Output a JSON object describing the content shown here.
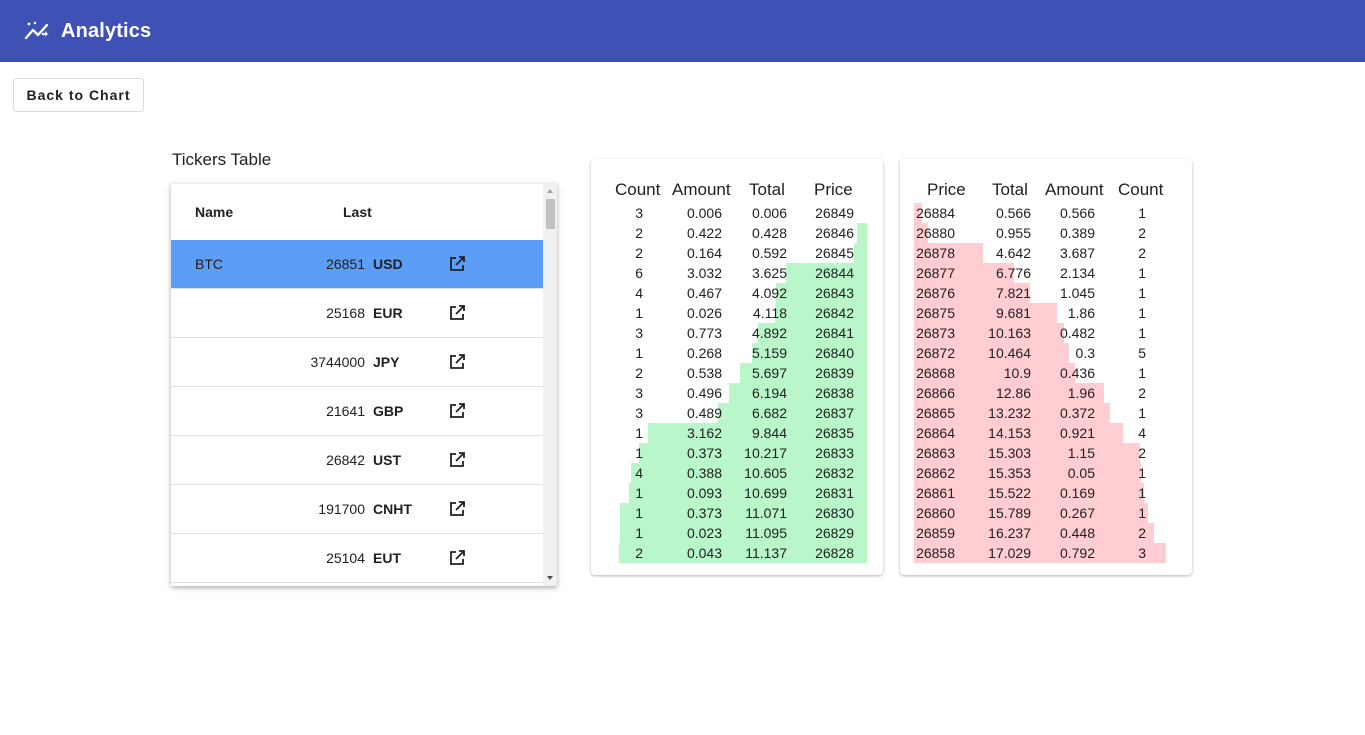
{
  "app": {
    "title": "Analytics",
    "logo_icon": "analytics-trend-icon",
    "bar_color": "#3f51b5"
  },
  "back_button": {
    "label": "Back to Chart"
  },
  "tickers": {
    "title": "Tickers Table",
    "headers": {
      "name": "Name",
      "last": "Last"
    },
    "selected_color": "#5b9df7",
    "rows": [
      {
        "name": "BTC",
        "last": "26851",
        "currency": "USD",
        "icon": "open-in-new-icon"
      },
      {
        "name": "",
        "last": "25168",
        "currency": "EUR",
        "icon": "open-in-new-icon"
      },
      {
        "name": "",
        "last": "3744000",
        "currency": "JPY",
        "icon": "open-in-new-icon"
      },
      {
        "name": "",
        "last": "21641",
        "currency": "GBP",
        "icon": "open-in-new-icon"
      },
      {
        "name": "",
        "last": "26842",
        "currency": "UST",
        "icon": "open-in-new-icon"
      },
      {
        "name": "",
        "last": "191700",
        "currency": "CNHT",
        "icon": "open-in-new-icon"
      },
      {
        "name": "",
        "last": "25104",
        "currency": "EUT",
        "icon": "open-in-new-icon"
      }
    ]
  },
  "bids": {
    "headers": {
      "count": "Count",
      "amount": "Amount",
      "total": "Total",
      "price": "Price"
    },
    "bar_color": "#b9f6ca",
    "max_total": 11.137,
    "rows": [
      {
        "count": "3",
        "amount": "0.006",
        "total": "0.006",
        "price": "26849"
      },
      {
        "count": "2",
        "amount": "0.422",
        "total": "0.428",
        "price": "26846"
      },
      {
        "count": "2",
        "amount": "0.164",
        "total": "0.592",
        "price": "26845"
      },
      {
        "count": "6",
        "amount": "3.032",
        "total": "3.625",
        "price": "26844"
      },
      {
        "count": "4",
        "amount": "0.467",
        "total": "4.092",
        "price": "26843"
      },
      {
        "count": "1",
        "amount": "0.026",
        "total": "4.118",
        "price": "26842"
      },
      {
        "count": "3",
        "amount": "0.773",
        "total": "4.892",
        "price": "26841"
      },
      {
        "count": "1",
        "amount": "0.268",
        "total": "5.159",
        "price": "26840"
      },
      {
        "count": "2",
        "amount": "0.538",
        "total": "5.697",
        "price": "26839"
      },
      {
        "count": "3",
        "amount": "0.496",
        "total": "6.194",
        "price": "26838"
      },
      {
        "count": "3",
        "amount": "0.489",
        "total": "6.682",
        "price": "26837"
      },
      {
        "count": "1",
        "amount": "3.162",
        "total": "9.844",
        "price": "26835"
      },
      {
        "count": "1",
        "amount": "0.373",
        "total": "10.217",
        "price": "26833"
      },
      {
        "count": "4",
        "amount": "0.388",
        "total": "10.605",
        "price": "26832"
      },
      {
        "count": "1",
        "amount": "0.093",
        "total": "10.699",
        "price": "26831"
      },
      {
        "count": "1",
        "amount": "0.373",
        "total": "11.071",
        "price": "26830"
      },
      {
        "count": "1",
        "amount": "0.023",
        "total": "11.095",
        "price": "26829"
      },
      {
        "count": "2",
        "amount": "0.043",
        "total": "11.137",
        "price": "26828"
      }
    ]
  },
  "asks": {
    "headers": {
      "price": "Price",
      "total": "Total",
      "amount": "Amount",
      "count": "Count"
    },
    "bar_color": "#ffcdd2",
    "max_total": 17.029,
    "rows": [
      {
        "price": "26884",
        "total": "0.566",
        "amount": "0.566",
        "count": "1"
      },
      {
        "price": "26880",
        "total": "0.955",
        "amount": "0.389",
        "count": "2"
      },
      {
        "price": "26878",
        "total": "4.642",
        "amount": "3.687",
        "count": "2"
      },
      {
        "price": "26877",
        "total": "6.776",
        "amount": "2.134",
        "count": "1"
      },
      {
        "price": "26876",
        "total": "7.821",
        "amount": "1.045",
        "count": "1"
      },
      {
        "price": "26875",
        "total": "9.681",
        "amount": "1.86",
        "count": "1"
      },
      {
        "price": "26873",
        "total": "10.163",
        "amount": "0.482",
        "count": "1"
      },
      {
        "price": "26872",
        "total": "10.464",
        "amount": "0.3",
        "count": "5"
      },
      {
        "price": "26868",
        "total": "10.9",
        "amount": "0.436",
        "count": "1"
      },
      {
        "price": "26866",
        "total": "12.86",
        "amount": "1.96",
        "count": "2"
      },
      {
        "price": "26865",
        "total": "13.232",
        "amount": "0.372",
        "count": "1"
      },
      {
        "price": "26864",
        "total": "14.153",
        "amount": "0.921",
        "count": "4"
      },
      {
        "price": "26863",
        "total": "15.303",
        "amount": "1.15",
        "count": "2"
      },
      {
        "price": "26862",
        "total": "15.353",
        "amount": "0.05",
        "count": "1"
      },
      {
        "price": "26861",
        "total": "15.522",
        "amount": "0.169",
        "count": "1"
      },
      {
        "price": "26860",
        "total": "15.789",
        "amount": "0.267",
        "count": "1"
      },
      {
        "price": "26859",
        "total": "16.237",
        "amount": "0.448",
        "count": "2"
      },
      {
        "price": "26858",
        "total": "17.029",
        "amount": "0.792",
        "count": "3"
      }
    ]
  }
}
